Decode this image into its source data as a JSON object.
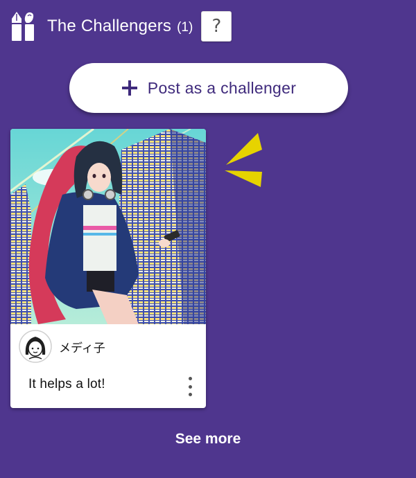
{
  "header": {
    "title": "The Challengers",
    "count": "(1)",
    "help_label": "?",
    "icon": "pen-brush-icon"
  },
  "post_button": {
    "label": "Post as a challenger",
    "icon": "plus-icon"
  },
  "challenges": [
    {
      "author": "メディ子",
      "comment": "It helps a lot!",
      "avatar_icon": "girl-avatar-icon",
      "menu_icon": "more-vertical-icon"
    }
  ],
  "footer": {
    "see_more_label": "See more"
  },
  "colors": {
    "background": "#4f368e",
    "accent_text": "#3f2a7c",
    "card": "#ffffff",
    "sparkle": "#e6d300"
  }
}
